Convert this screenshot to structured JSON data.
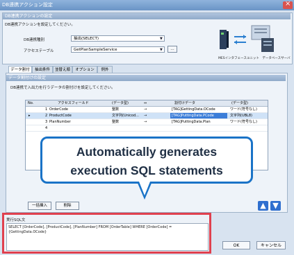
{
  "window": {
    "title": "DB連携アクション設定"
  },
  "top": {
    "header": "DB連携アクションの設定",
    "desc": "DB連携アクションを設定してください。",
    "type_label": "DB連携種別",
    "type_value": "抽出(SELECT)",
    "table_label": "アクセステーブル",
    "table_value": "GetPlanSampleService",
    "diagram_caption": "MESインタフェースユニット　データベースサーバ"
  },
  "tabs": [
    "データ割付け",
    "抽出条件",
    "並替え順",
    "オプション",
    "例外"
  ],
  "mapping": {
    "header": "データ割付けの設定",
    "desc": "DB連携で入出力を行うデータの割付けを設定してください。",
    "columns": [
      "No.",
      "アクセスフィールド",
      "(データ型)",
      "⇔",
      "割付けデータ",
      "(データ型)"
    ],
    "rows": [
      {
        "no": "1",
        "field": "OrderCode",
        "type": "整数",
        "arrow": "→",
        "data": "[TAG]GettingData.OCode",
        "dtype": "ワード(符号なし)"
      },
      {
        "no": "2",
        "field": "ProductCode",
        "type": "文字列(Unicod...",
        "arrow": "→",
        "data": "[TAG]PuttingData.PCode",
        "dtype": "文字列(UBL8)"
      },
      {
        "no": "3",
        "field": "PlanNumber",
        "type": "整数",
        "arrow": "→",
        "data": "[TAG]PuttingData.Plan",
        "dtype": "ワード(符号なし)"
      },
      {
        "no": "4",
        "field": "",
        "type": "",
        "arrow": "",
        "data": "",
        "dtype": ""
      }
    ],
    "selected_marker": "▸"
  },
  "callout": {
    "line1": "Automatically generates",
    "line2": "execution SQL statements"
  },
  "buttons": {
    "batch_insert": "一括挿入",
    "delete": "削除",
    "ok": "OK",
    "cancel": "キャンセル",
    "up": "▲",
    "down": "▼"
  },
  "sql": {
    "label": "実行SQL文",
    "text1": "SELECT [OrderCode], [ProductCode], [PlanNumber] FROM [OrderTable] WHERE [OrderCode] =",
    "text2": "{GettingData.OCode}"
  },
  "colors": {
    "accent": "#1a73c7",
    "highlight": "#e0404e"
  }
}
